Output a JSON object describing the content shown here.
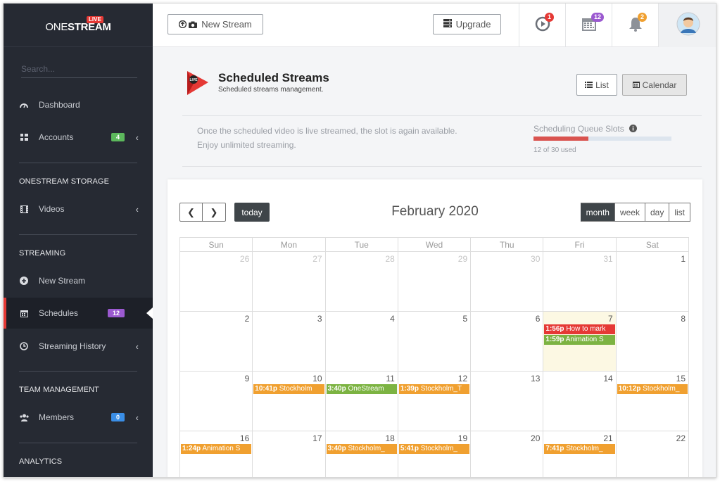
{
  "app": {
    "brand": "ONESTREAM",
    "brand_prefix": "ONE",
    "brand_suffix": "STREAM",
    "live_badge": "LIVE"
  },
  "sidebar": {
    "search_placeholder": "Search...",
    "items": [
      {
        "label": "Dashboard"
      },
      {
        "label": "Accounts",
        "badge": "4",
        "badge_color": "#5cb85c"
      },
      {
        "label": "Videos"
      },
      {
        "label": "New Stream"
      },
      {
        "label": "Schedules",
        "badge": "12",
        "badge_color": "#9b59d0"
      },
      {
        "label": "Streaming History"
      },
      {
        "label": "Members",
        "badge": "0",
        "badge_color": "#3a8ee6"
      }
    ],
    "sections": [
      "ONESTREAM STORAGE",
      "STREAMING",
      "TEAM MANAGEMENT",
      "ANALYTICS"
    ]
  },
  "topbar": {
    "new_stream_label": "New Stream",
    "upgrade_label": "Upgrade",
    "icons": [
      {
        "name": "stream-icon",
        "count": "1",
        "color": "#e53935"
      },
      {
        "name": "calendar-icon",
        "count": "12",
        "color": "#9b59d0"
      },
      {
        "name": "bell-icon",
        "count": "2",
        "color": "#f0a030"
      }
    ]
  },
  "page": {
    "title": "Scheduled Streams",
    "subtitle": "Scheduled streams management.",
    "list_label": "List",
    "calendar_label": "Calendar",
    "info_line1": "Once the scheduled video is live streamed, the slot is again available.",
    "info_line2": "Enjoy unlimited streaming.",
    "queue_label": "Scheduling Queue Slots",
    "queue_used_text": "12 of 30 used",
    "queue_fraction": 0.4
  },
  "calendar": {
    "title": "February 2020",
    "today_label": "today",
    "views": [
      "month",
      "week",
      "day",
      "list"
    ],
    "weekdays": [
      "Sun",
      "Mon",
      "Tue",
      "Wed",
      "Thu",
      "Fri",
      "Sat"
    ],
    "weeks": [
      [
        {
          "d": "26",
          "other": true
        },
        {
          "d": "27",
          "other": true
        },
        {
          "d": "28",
          "other": true
        },
        {
          "d": "29",
          "other": true
        },
        {
          "d": "30",
          "other": true
        },
        {
          "d": "31",
          "other": true
        },
        {
          "d": "1"
        }
      ],
      [
        {
          "d": "2"
        },
        {
          "d": "3"
        },
        {
          "d": "4"
        },
        {
          "d": "5"
        },
        {
          "d": "6"
        },
        {
          "d": "7",
          "today": true,
          "events": [
            {
              "time": "1:56p",
              "title": "How to mark",
              "color": "#e53935"
            },
            {
              "time": "1:59p",
              "title": "Animation S",
              "color": "#7cb342"
            }
          ]
        },
        {
          "d": "8"
        }
      ],
      [
        {
          "d": "9"
        },
        {
          "d": "10",
          "events": [
            {
              "time": "10:41p",
              "title": "Stockholm",
              "color": "#f0a030"
            }
          ]
        },
        {
          "d": "11",
          "events": [
            {
              "time": "3:40p",
              "title": "OneStream",
              "color": "#7cb342"
            }
          ]
        },
        {
          "d": "12",
          "events": [
            {
              "time": "1:39p",
              "title": "Stockholm_T",
              "color": "#f0a030"
            }
          ]
        },
        {
          "d": "13"
        },
        {
          "d": "14"
        },
        {
          "d": "15",
          "events": [
            {
              "time": "10:12p",
              "title": "Stockholm_",
              "color": "#f0a030"
            }
          ]
        }
      ],
      [
        {
          "d": "16",
          "events": [
            {
              "time": "1:24p",
              "title": "Animation S",
              "color": "#f0a030"
            }
          ]
        },
        {
          "d": "17"
        },
        {
          "d": "18",
          "events": [
            {
              "time": "3:40p",
              "title": "Stockholm_",
              "color": "#f0a030"
            }
          ]
        },
        {
          "d": "19",
          "events": [
            {
              "time": "5:41p",
              "title": "Stockholm_",
              "color": "#f0a030"
            }
          ]
        },
        {
          "d": "20"
        },
        {
          "d": "21",
          "events": [
            {
              "time": "7:41p",
              "title": "Stockholm_",
              "color": "#f0a030"
            }
          ]
        },
        {
          "d": "22"
        }
      ]
    ]
  }
}
